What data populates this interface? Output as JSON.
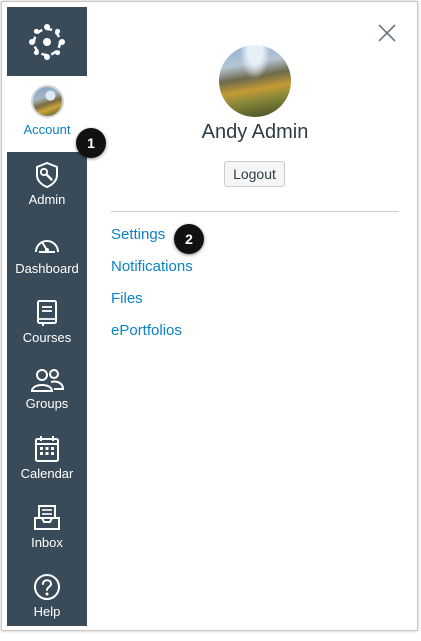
{
  "nav": {
    "account_label": "Account",
    "items": [
      {
        "label": "Admin",
        "icon": "shield-wrench-icon"
      },
      {
        "label": "Dashboard",
        "icon": "speedometer-icon"
      },
      {
        "label": "Courses",
        "icon": "book-icon"
      },
      {
        "label": "Groups",
        "icon": "people-icon"
      },
      {
        "label": "Calendar",
        "icon": "calendar-icon"
      },
      {
        "label": "Inbox",
        "icon": "inbox-icon"
      },
      {
        "label": "Help",
        "icon": "question-circle-icon"
      }
    ]
  },
  "tray": {
    "user_name": "Andy Admin",
    "logout_label": "Logout",
    "links": [
      "Settings",
      "Notifications",
      "Files",
      "ePortfolios"
    ]
  },
  "callouts": [
    "1",
    "2"
  ],
  "colors": {
    "nav_bg": "#394b58",
    "link": "#0a83c5",
    "text": "#2d3b45"
  }
}
